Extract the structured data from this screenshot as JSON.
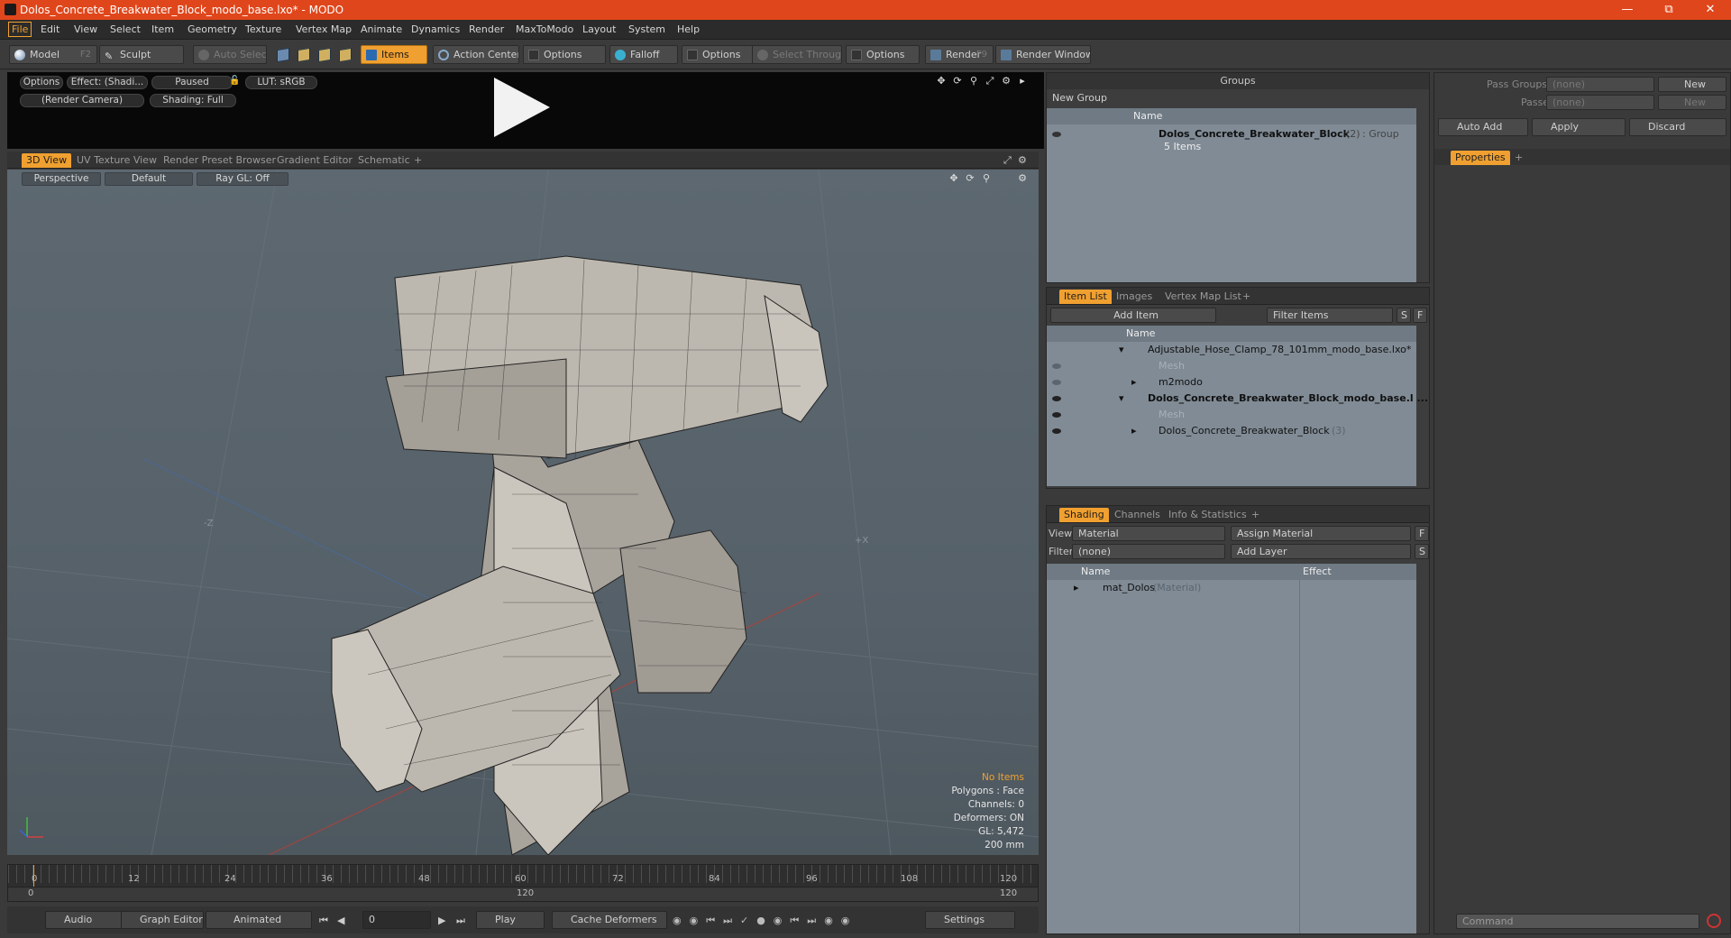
{
  "titlebar": {
    "title": "Dolos_Concrete_Breakwater_Block_modo_base.lxo* - MODO"
  },
  "menubar": {
    "items": [
      "File",
      "Edit",
      "View",
      "Select",
      "Item",
      "Geometry",
      "Texture",
      "Vertex Map",
      "Animate",
      "Dynamics",
      "Render",
      "MaxToModo",
      "Layout",
      "System",
      "Help"
    ]
  },
  "toolbar": {
    "model": "Model",
    "model_key": "F2",
    "sculpt": "Sculpt",
    "auto_select": "Auto Select",
    "items": "Items",
    "action_center": "Action Center",
    "options1": "Options",
    "falloff": "Falloff",
    "options2": "Options",
    "select_through": "Select Through",
    "options3": "Options",
    "render": "Render",
    "render_key": "F9",
    "render_window": "Render Window"
  },
  "preview": {
    "options": "Options",
    "effect": "Effect: (Shadi...",
    "paused": "Paused",
    "lut": "LUT: sRGB",
    "camera": "(Render Camera)",
    "shading": "Shading: Full"
  },
  "view_tabs": [
    "3D View",
    "UV Texture View",
    "Render Preset Browser",
    "Gradient Editor",
    "Schematic",
    "+"
  ],
  "viewbar": {
    "perspective": "Perspective",
    "default": "Default",
    "raygl": "Ray GL: Off"
  },
  "axis_labels": {
    "neg_z": "-Z",
    "pos_x": "+X"
  },
  "info": {
    "no_items": "No Items",
    "polygons": "Polygons : Face",
    "channels": "Channels: 0",
    "deformers": "Deformers: ON",
    "gl": "GL: 5,472",
    "scale": "200 mm"
  },
  "timeline": {
    "ticks": [
      "0",
      "12",
      "24",
      "36",
      "48",
      "60",
      "72",
      "84",
      "96",
      "108",
      "120"
    ],
    "start": "0",
    "end": "120",
    "mid": "120"
  },
  "bottombar": {
    "audio": "Audio",
    "graph_editor": "Graph Editor",
    "animated": "Animated",
    "frame": "0",
    "play": "Play",
    "cache": "Cache Deformers",
    "settings": "Settings"
  },
  "groups": {
    "title": "Groups",
    "new_group": "New Group",
    "col_name": "Name",
    "item_name": "Dolos_Concrete_Breakwater_Block",
    "item_count": "(2)",
    "item_type": ": Group",
    "item_sub": "5 Items"
  },
  "itemlist": {
    "tabs": [
      "Item List",
      "Images",
      "Vertex Map List",
      "+"
    ],
    "add_item": "Add Item",
    "filter": "Filter Items",
    "s": "S",
    "f": "F",
    "col_name": "Name",
    "rows": [
      {
        "label": "Adjustable_Hose_Clamp_78_101mm_modo_base.lxo*",
        "extra": ""
      },
      {
        "label": "Mesh",
        "extra": ""
      },
      {
        "label": "m2modo",
        "extra": ""
      },
      {
        "label": "Dolos_Concrete_Breakwater_Block_modo_base.l ...",
        "extra": ""
      },
      {
        "label": "Mesh",
        "extra": ""
      },
      {
        "label": "Dolos_Concrete_Breakwater_Block",
        "extra": "(3)"
      }
    ]
  },
  "shading": {
    "tabs": [
      "Shading",
      "Channels",
      "Info & Statistics",
      "+"
    ],
    "view_label": "View",
    "view_value": "Material",
    "assign": "Assign Material",
    "f": "F",
    "filter_label": "Filter",
    "filter_value": "(none)",
    "add_layer": "Add Layer",
    "s": "S",
    "col_name": "Name",
    "col_effect": "Effect",
    "row_name": "mat_Dolos",
    "row_type": "(Material)"
  },
  "right": {
    "pass_groups": "Pass Groups",
    "passes": "Passes",
    "none1": "(none)",
    "none2": "(none)",
    "new1": "New",
    "new2": "New",
    "auto_add": "Auto Add",
    "apply": "Apply",
    "discard": "Discard",
    "properties": "Properties",
    "plus": "+",
    "command": "Command"
  }
}
